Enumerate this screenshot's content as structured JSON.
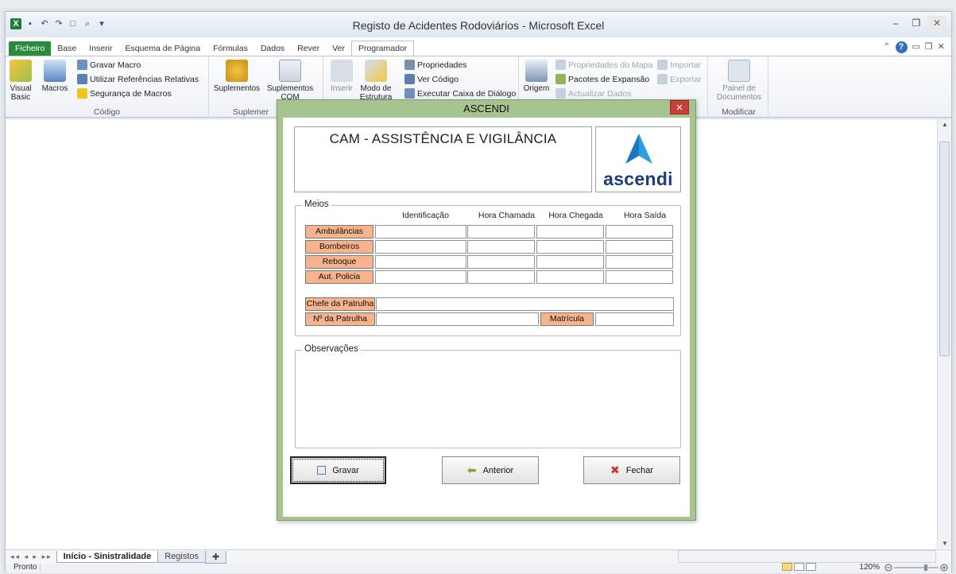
{
  "window": {
    "title": "Registo de Acidentes Rodoviários - Microsoft Excel"
  },
  "ribbon_tabs": [
    "Ficheiro",
    "Base",
    "Inserir",
    "Esquema de Página",
    "Fórmulas",
    "Dados",
    "Rever",
    "Ver",
    "Programador"
  ],
  "ribbon": {
    "codigo": {
      "label": "Código",
      "visual_basic": "Visual Basic",
      "macros": "Macros",
      "gravar_macro": "Gravar Macro",
      "referencias": "Utilizar Referências Relativas",
      "seguranca": "Segurança de Macros"
    },
    "suplementos": {
      "label": "Suplemer",
      "suplementos": "Suplementos",
      "suplementos_com": "Suplementos COM"
    },
    "controlos": {
      "inserir": "Inserir",
      "modo": "Modo de Estrutura",
      "propriedades": "Propriedades",
      "ver_codigo": "Ver Código",
      "executar": "Executar Caixa de Diálogo"
    },
    "xml": {
      "origem": "Origem",
      "prop_mapa": "Propriedades do Mapa",
      "pacotes": "Pacotes de Expansão",
      "actualizar": "Actualizar Dados",
      "importar": "Importar",
      "exportar": "Exportar"
    },
    "modificar": {
      "label": "Modificar",
      "painel": "Painel de Documentos"
    }
  },
  "sheet_tabs": [
    "Início - Sinistralidade",
    "Registos"
  ],
  "status": {
    "ready": "Pronto",
    "zoom": "120%"
  },
  "dialog": {
    "title": "ASCENDI",
    "header": "CAM - ASSISTÊNCIA E VIGILÂNCIA",
    "logo_word": "ascendi",
    "meios_legend": "Meios",
    "columns": [
      "Identificação",
      "Hora Chamada",
      "Hora Chegada",
      "Hora Saída"
    ],
    "rows": [
      "Ambulâncias",
      "Bombeiros",
      "Reboque",
      "Aut. Policia"
    ],
    "chefe_label": "Chefe da Patrulha",
    "numero_label": "Nº da Patrulha",
    "matricula_label": "Matrícula",
    "observacoes_legend": "Observações",
    "buttons": {
      "gravar": "Gravar",
      "anterior": "Anterior",
      "fechar": "Fechar"
    }
  },
  "colors": {
    "dialog_frame": "#a7c38f",
    "label_orange": "#f7b38b",
    "brand_blue": "#1c3d7a",
    "logo_light_blue": "#2aa0e0"
  }
}
